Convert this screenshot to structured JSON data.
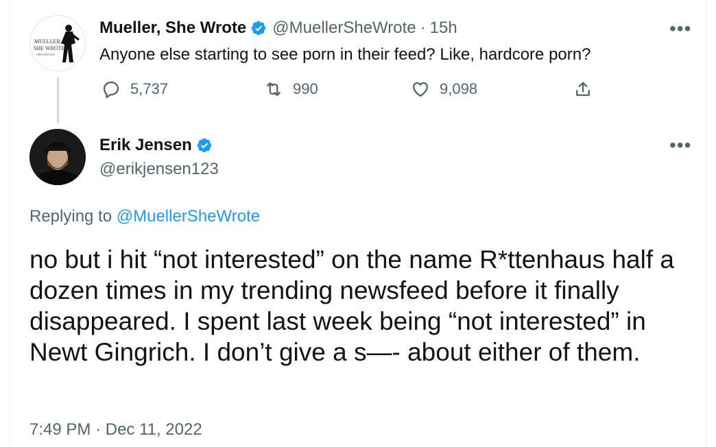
{
  "parent_tweet": {
    "display_name": "Mueller, She Wrote",
    "handle": "@MuellerSheWrote",
    "separator": "·",
    "time": "15h",
    "text": "Anyone else starting to see porn in their feed? Like, hardcore porn?",
    "avatar_text": [
      "MUELLER,",
      "SHE WROTE",
      "THE PODCAST"
    ],
    "stats": {
      "replies": "5,737",
      "retweets": "990",
      "likes": "9,098"
    }
  },
  "reply_tweet": {
    "display_name": "Erik Jensen",
    "handle": "@erikjensen123",
    "replying_prefix": "Replying to",
    "replying_to": "@MuellerSheWrote",
    "text": "no but i hit “not interested” on the name R*ttenhaus half a dozen times in my trending newsfeed before it finally disappeared. I spent last week being “not interested” in Newt Gingrich. I don’t give a s—- about either of them.",
    "time": "7:49 PM",
    "separator": "·",
    "date": "Dec 11, 2022"
  },
  "more_label": "•••",
  "icons": {
    "verified": "verified-badge-icon",
    "reply": "reply-icon",
    "retweet": "retweet-icon",
    "like": "heart-icon",
    "share": "share-icon",
    "more": "more-options-icon"
  },
  "colors": {
    "accent": "#1d9bf0",
    "secondary_text": "#536471",
    "primary_text": "#0f1419"
  }
}
